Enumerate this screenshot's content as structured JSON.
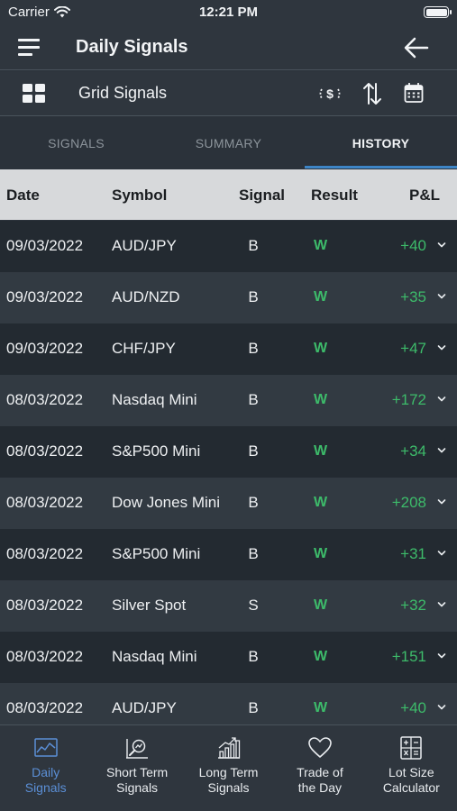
{
  "status": {
    "carrier": "Carrier",
    "time": "12:21 PM"
  },
  "header": {
    "title": "Daily Signals"
  },
  "subheader": {
    "title": "Grid Signals"
  },
  "tabs": [
    {
      "label": "SIGNALS"
    },
    {
      "label": "SUMMARY"
    },
    {
      "label": "HISTORY"
    }
  ],
  "table": {
    "columns": {
      "date": "Date",
      "symbol": "Symbol",
      "signal": "Signal",
      "result": "Result",
      "pnl": "P&L"
    },
    "rows": [
      {
        "date": "09/03/2022",
        "symbol": "AUD/JPY",
        "signal": "B",
        "result": "W",
        "pnl": "+40"
      },
      {
        "date": "09/03/2022",
        "symbol": "AUD/NZD",
        "signal": "B",
        "result": "W",
        "pnl": "+35"
      },
      {
        "date": "09/03/2022",
        "symbol": "CHF/JPY",
        "signal": "B",
        "result": "W",
        "pnl": "+47"
      },
      {
        "date": "08/03/2022",
        "symbol": "Nasdaq Mini",
        "signal": "B",
        "result": "W",
        "pnl": "+172"
      },
      {
        "date": "08/03/2022",
        "symbol": "S&P500 Mini",
        "signal": "B",
        "result": "W",
        "pnl": "+34"
      },
      {
        "date": "08/03/2022",
        "symbol": "Dow Jones Mini",
        "signal": "B",
        "result": "W",
        "pnl": "+208"
      },
      {
        "date": "08/03/2022",
        "symbol": "S&P500 Mini",
        "signal": "B",
        "result": "W",
        "pnl": "+31"
      },
      {
        "date": "08/03/2022",
        "symbol": "Silver Spot",
        "signal": "S",
        "result": "W",
        "pnl": "+32"
      },
      {
        "date": "08/03/2022",
        "symbol": "Nasdaq Mini",
        "signal": "B",
        "result": "W",
        "pnl": "+151"
      },
      {
        "date": "08/03/2022",
        "symbol": "AUD/JPY",
        "signal": "B",
        "result": "W",
        "pnl": "+40"
      }
    ]
  },
  "bottom_nav": [
    {
      "label_line1": "Daily",
      "label_line2": "Signals",
      "icon": "chart-icon"
    },
    {
      "label_line1": "Short Term",
      "label_line2": "Signals",
      "icon": "magnifier-chart-icon"
    },
    {
      "label_line1": "Long Term",
      "label_line2": "Signals",
      "icon": "growth-bars-icon"
    },
    {
      "label_line1": "Trade of",
      "label_line2": "the Day",
      "icon": "heart-icon"
    },
    {
      "label_line1": "Lot Size",
      "label_line2": "Calculator",
      "icon": "calculator-icon"
    }
  ],
  "colors": {
    "accent": "#3d85c6",
    "win": "#3dbb6a",
    "active_nav": "#5b8fd6"
  }
}
